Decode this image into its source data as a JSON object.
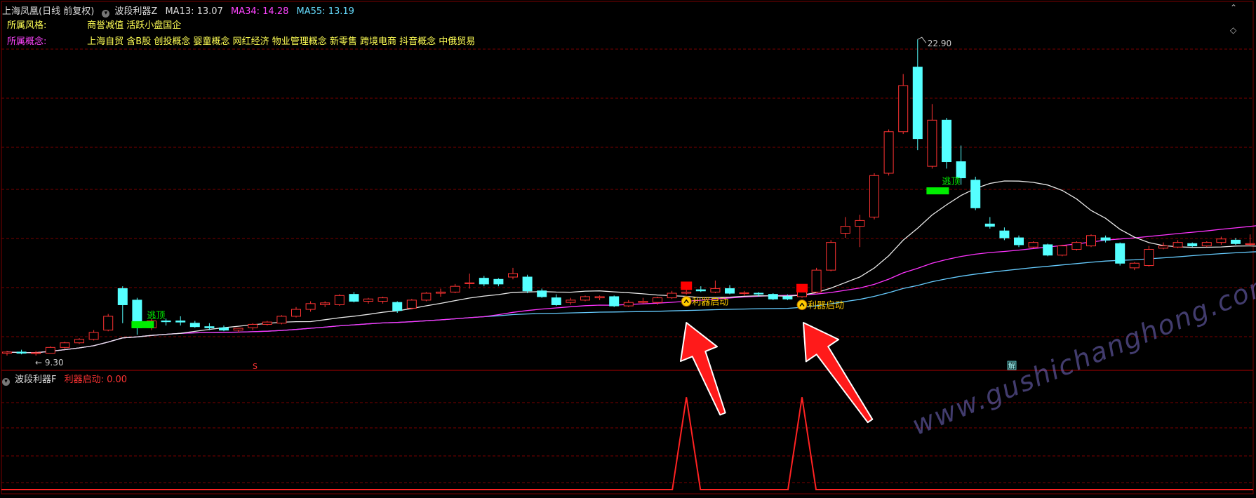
{
  "main_panel": {
    "stock_title": "上海凤凰(日线 前复权)",
    "indicator_name": "波段利器Z",
    "ma13": "MA13: 13.07",
    "ma34": "MA34: 14.28",
    "ma55": "MA55: 13.19",
    "style_label": "所属风格:",
    "style_value": "商誉减值 活跃小盘国企",
    "concept_label": "所属概念:",
    "concept_value": "上海自贸 含B股 创投概念 婴童概念 网红经济 物业管理概念 新零售 跨境电商 抖音概念 中俄贸易",
    "high_label": "22.90",
    "low_label": "9.30",
    "escape_label": "逃顶",
    "start_label": "利器启动",
    "marker_s": "S",
    "marker_jie": "解"
  },
  "sub_panel": {
    "indicator_name": "波段利器F",
    "value_label": "利器启动: 0.00"
  },
  "watermark": "www.gushichanghong.com",
  "colors": {
    "up": "#ff3333",
    "down": "#55ffff",
    "ma13": "#e8e8e8",
    "ma34": "#ff33ff",
    "ma55": "#66ccff",
    "grid": "#7a0000",
    "green_flag": "#00ee00",
    "red_block": "#ff0000"
  },
  "chart_data": {
    "type": "candlestick",
    "ylim": [
      8.8,
      24.0
    ],
    "candles": [
      {
        "o": 9.3,
        "h": 9.4,
        "l": 9.2,
        "c": 9.35
      },
      {
        "o": 9.35,
        "h": 9.45,
        "l": 9.25,
        "c": 9.3
      },
      {
        "o": 9.3,
        "h": 9.4,
        "l": 9.2,
        "c": 9.32
      },
      {
        "o": 9.3,
        "h": 9.6,
        "l": 9.3,
        "c": 9.55
      },
      {
        "o": 9.55,
        "h": 9.8,
        "l": 9.5,
        "c": 9.75
      },
      {
        "o": 9.75,
        "h": 9.95,
        "l": 9.7,
        "c": 9.9
      },
      {
        "o": 9.9,
        "h": 10.3,
        "l": 9.85,
        "c": 10.2
      },
      {
        "o": 10.3,
        "h": 11.0,
        "l": 10.25,
        "c": 10.9
      },
      {
        "o": 12.1,
        "h": 12.2,
        "l": 10.6,
        "c": 11.4
      },
      {
        "o": 11.6,
        "h": 11.7,
        "l": 10.1,
        "c": 10.4
      },
      {
        "o": 10.4,
        "h": 10.8,
        "l": 10.3,
        "c": 10.7
      },
      {
        "o": 10.7,
        "h": 10.8,
        "l": 10.5,
        "c": 10.68
      },
      {
        "o": 10.7,
        "h": 10.9,
        "l": 10.5,
        "c": 10.65
      },
      {
        "o": 10.6,
        "h": 10.7,
        "l": 10.4,
        "c": 10.45
      },
      {
        "o": 10.45,
        "h": 10.6,
        "l": 10.3,
        "c": 10.4
      },
      {
        "o": 10.4,
        "h": 10.5,
        "l": 10.25,
        "c": 10.3
      },
      {
        "o": 10.3,
        "h": 10.4,
        "l": 10.2,
        "c": 10.38
      },
      {
        "o": 10.4,
        "h": 10.6,
        "l": 10.3,
        "c": 10.55
      },
      {
        "o": 10.55,
        "h": 10.7,
        "l": 10.5,
        "c": 10.65
      },
      {
        "o": 10.6,
        "h": 10.95,
        "l": 10.55,
        "c": 10.9
      },
      {
        "o": 10.9,
        "h": 11.3,
        "l": 10.85,
        "c": 11.2
      },
      {
        "o": 11.2,
        "h": 11.55,
        "l": 11.1,
        "c": 11.45
      },
      {
        "o": 11.4,
        "h": 11.55,
        "l": 11.3,
        "c": 11.48
      },
      {
        "o": 11.4,
        "h": 11.85,
        "l": 11.35,
        "c": 11.8
      },
      {
        "o": 11.85,
        "h": 11.95,
        "l": 11.5,
        "c": 11.55
      },
      {
        "o": 11.55,
        "h": 11.7,
        "l": 11.45,
        "c": 11.65
      },
      {
        "o": 11.55,
        "h": 11.75,
        "l": 11.45,
        "c": 11.7
      },
      {
        "o": 11.5,
        "h": 11.55,
        "l": 11.05,
        "c": 11.15
      },
      {
        "o": 11.25,
        "h": 11.65,
        "l": 11.2,
        "c": 11.6
      },
      {
        "o": 11.6,
        "h": 11.95,
        "l": 11.55,
        "c": 11.9
      },
      {
        "o": 11.9,
        "h": 12.1,
        "l": 11.75,
        "c": 11.95
      },
      {
        "o": 11.95,
        "h": 12.3,
        "l": 11.9,
        "c": 12.2
      },
      {
        "o": 12.35,
        "h": 12.75,
        "l": 12.1,
        "c": 12.35
      },
      {
        "o": 12.55,
        "h": 12.65,
        "l": 12.2,
        "c": 12.3
      },
      {
        "o": 12.5,
        "h": 12.55,
        "l": 12.2,
        "c": 12.3
      },
      {
        "o": 12.6,
        "h": 13.0,
        "l": 12.5,
        "c": 12.75
      },
      {
        "o": 12.6,
        "h": 12.7,
        "l": 11.9,
        "c": 12.0
      },
      {
        "o": 12.0,
        "h": 12.1,
        "l": 11.7,
        "c": 11.75
      },
      {
        "o": 11.7,
        "h": 11.85,
        "l": 11.35,
        "c": 11.4
      },
      {
        "o": 11.5,
        "h": 11.7,
        "l": 11.4,
        "c": 11.6
      },
      {
        "o": 11.6,
        "h": 11.8,
        "l": 11.55,
        "c": 11.75
      },
      {
        "o": 11.7,
        "h": 11.8,
        "l": 11.6,
        "c": 11.75
      },
      {
        "o": 11.75,
        "h": 11.8,
        "l": 11.3,
        "c": 11.35
      },
      {
        "o": 11.35,
        "h": 11.6,
        "l": 11.3,
        "c": 11.5
      },
      {
        "o": 11.5,
        "h": 11.7,
        "l": 11.45,
        "c": 11.55
      },
      {
        "o": 11.5,
        "h": 11.75,
        "l": 11.4,
        "c": 11.7
      },
      {
        "o": 11.7,
        "h": 12.0,
        "l": 11.65,
        "c": 11.9
      },
      {
        "o": 11.9,
        "h": 12.1,
        "l": 11.85,
        "c": 11.95
      },
      {
        "o": 12.05,
        "h": 12.2,
        "l": 11.95,
        "c": 12.0
      },
      {
        "o": 11.95,
        "h": 12.45,
        "l": 11.9,
        "c": 12.1
      },
      {
        "o": 12.1,
        "h": 12.25,
        "l": 11.85,
        "c": 11.9
      },
      {
        "o": 11.9,
        "h": 12.0,
        "l": 11.8,
        "c": 11.92
      },
      {
        "o": 11.9,
        "h": 11.95,
        "l": 11.75,
        "c": 11.88
      },
      {
        "o": 11.85,
        "h": 11.9,
        "l": 11.6,
        "c": 11.65
      },
      {
        "o": 11.75,
        "h": 11.85,
        "l": 11.6,
        "c": 11.65
      },
      {
        "o": 11.75,
        "h": 12.0,
        "l": 11.7,
        "c": 11.95
      },
      {
        "o": 11.95,
        "h": 13.0,
        "l": 11.9,
        "c": 12.9
      },
      {
        "o": 12.9,
        "h": 14.2,
        "l": 12.85,
        "c": 14.1
      },
      {
        "o": 14.5,
        "h": 15.2,
        "l": 14.3,
        "c": 14.8
      },
      {
        "o": 14.8,
        "h": 15.3,
        "l": 13.9,
        "c": 15.05
      },
      {
        "o": 15.2,
        "h": 17.1,
        "l": 15.1,
        "c": 17.0
      },
      {
        "o": 17.1,
        "h": 19.0,
        "l": 17.0,
        "c": 18.9
      },
      {
        "o": 18.9,
        "h": 21.4,
        "l": 18.8,
        "c": 20.9
      },
      {
        "o": 21.7,
        "h": 22.9,
        "l": 18.1,
        "c": 18.6
      },
      {
        "o": 17.4,
        "h": 20.1,
        "l": 17.3,
        "c": 19.4
      },
      {
        "o": 19.4,
        "h": 19.5,
        "l": 17.3,
        "c": 17.6
      },
      {
        "o": 17.6,
        "h": 18.3,
        "l": 16.6,
        "c": 16.9
      },
      {
        "o": 16.8,
        "h": 16.95,
        "l": 15.5,
        "c": 15.6
      },
      {
        "o": 14.9,
        "h": 15.2,
        "l": 14.7,
        "c": 14.8
      },
      {
        "o": 14.6,
        "h": 14.75,
        "l": 14.2,
        "c": 14.3
      },
      {
        "o": 14.3,
        "h": 14.4,
        "l": 13.9,
        "c": 14.0
      },
      {
        "o": 13.9,
        "h": 14.15,
        "l": 13.85,
        "c": 14.1
      },
      {
        "o": 14.0,
        "h": 14.05,
        "l": 13.5,
        "c": 13.55
      },
      {
        "o": 13.55,
        "h": 14.0,
        "l": 13.5,
        "c": 13.95
      },
      {
        "o": 13.8,
        "h": 14.15,
        "l": 13.75,
        "c": 14.1
      },
      {
        "o": 13.95,
        "h": 14.45,
        "l": 13.9,
        "c": 14.4
      },
      {
        "o": 14.3,
        "h": 14.4,
        "l": 14.1,
        "c": 14.2
      },
      {
        "o": 14.05,
        "h": 14.1,
        "l": 13.1,
        "c": 13.2
      },
      {
        "o": 13.0,
        "h": 13.25,
        "l": 12.9,
        "c": 13.2
      },
      {
        "o": 13.1,
        "h": 13.95,
        "l": 13.05,
        "c": 13.8
      },
      {
        "o": 13.85,
        "h": 14.1,
        "l": 13.8,
        "c": 13.95
      },
      {
        "o": 13.9,
        "h": 14.2,
        "l": 13.85,
        "c": 14.1
      },
      {
        "o": 14.05,
        "h": 14.1,
        "l": 13.9,
        "c": 13.95
      },
      {
        "o": 13.95,
        "h": 14.15,
        "l": 13.9,
        "c": 14.1
      },
      {
        "o": 14.1,
        "h": 14.35,
        "l": 14.0,
        "c": 14.25
      },
      {
        "o": 14.2,
        "h": 14.3,
        "l": 14.0,
        "c": 14.05
      },
      {
        "o": 14.05,
        "h": 14.45,
        "l": 13.95,
        "c": 14.05
      },
      {
        "o": 14.2,
        "h": 14.3,
        "l": 13.8,
        "c": 13.85
      },
      {
        "o": 13.85,
        "h": 13.95,
        "l": 13.6,
        "c": 13.65
      }
    ],
    "escape_top_index": [
      9,
      64
    ],
    "start_signal_index": [
      47,
      55
    ],
    "sub_panel_ylim": [
      0,
      1.2
    ],
    "sub_panel_signal_values": [
      1,
      1
    ]
  }
}
